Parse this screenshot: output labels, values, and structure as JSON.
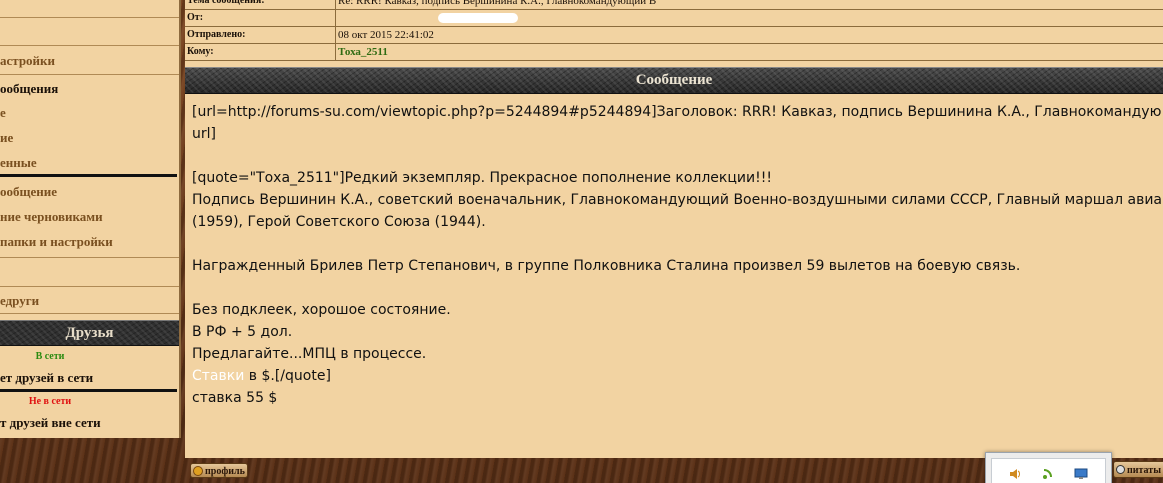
{
  "sidebar": {
    "items": [
      {
        "label": "астройки",
        "style": "normal"
      },
      {
        "label": "ообщения",
        "style": "dark"
      },
      {
        "label": "е",
        "style": "normal"
      },
      {
        "label": "ие",
        "style": "normal"
      },
      {
        "label": "енные",
        "style": "normal"
      },
      {
        "label": "ообщение",
        "style": "normal"
      },
      {
        "label": "ние черновиками",
        "style": "normal"
      },
      {
        "label": " папки и настройки",
        "style": "normal"
      },
      {
        "label": "едруги",
        "style": "normal"
      }
    ],
    "friends": {
      "title": "Друзья",
      "online_label": "В сети",
      "online_empty": "ет друзей в сети",
      "offline_label": "Не в сети",
      "offline_empty": "т друзей вне сети",
      "online_color": "#2a8a10",
      "offline_color": "#e01010"
    }
  },
  "header": {
    "subject_label": "Тема сообщения:",
    "subject_value": "Re: RRR! Кавказ, подпись Вершинина К.А., Главнокомандующий В",
    "from_label": "От:",
    "sent_label": "Отправлено:",
    "sent_value": "08 окт 2015 22:41:02",
    "to_label": "Кому:",
    "to_value": "Тоха_2511"
  },
  "message": {
    "section_title": "Сообщение",
    "lines": [
      "[url=http://forums-su.com/viewtopic.php?p=5244894#p5244894]Заголовок: RRR! Кавказ, подпись Вершинина К.А., Главнокомандующ",
      "url]",
      "",
      "[quote=\"Тоха_2511\"]Редкий экземпляр. Прекрасное пополнение коллекции!!!",
      "Подпись Вершинин К.А., советский военачальник, Главнокомандующий Военно-воздушными силами СССР, Главный маршал авиац",
      "(1959), Герой Советского Союза (1944).",
      "",
      "Награжденный Брилев Петр Степанович, в группе Полковника Сталина произвел 59 вылетов на боевую связь.",
      "",
      "Без подклеек, хорошое состояние.",
      "В РФ + 5 дол.",
      "Предлагайте...МПЦ в процессе."
    ],
    "stavki_word": "Ставки",
    "stavki_rest": " в $.[/quote]",
    "last_line": "ставка 55 $"
  },
  "buttons": {
    "profile": "профиль",
    "quote": "питаты"
  },
  "colors": {
    "panel_bg": "#f2d3a2",
    "link_green": "#2f6b12"
  }
}
